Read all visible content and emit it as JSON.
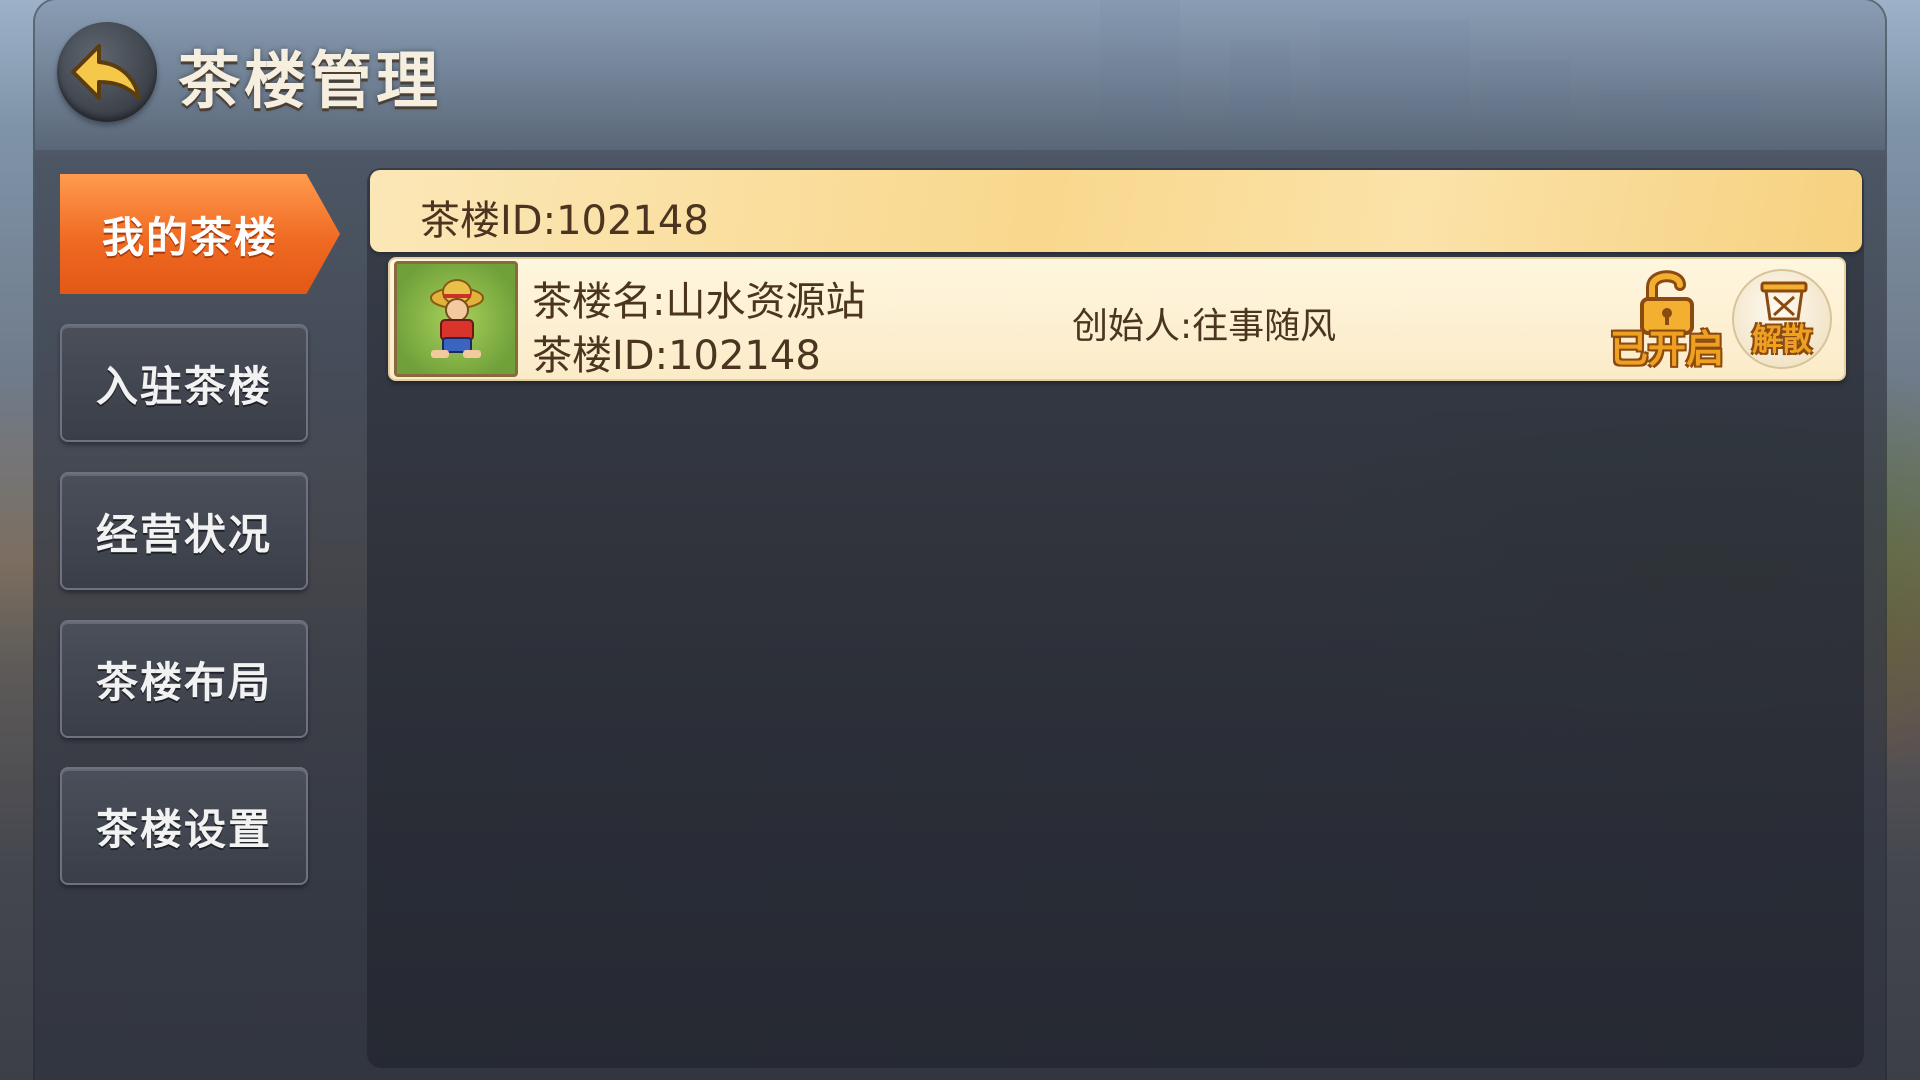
{
  "header": {
    "title": "茶楼管理",
    "back_icon": "back-arrow-icon"
  },
  "sidebar": {
    "items": [
      {
        "label": "我的茶楼",
        "active": true
      },
      {
        "label": "入驻茶楼",
        "active": false
      },
      {
        "label": "经营状况",
        "active": false
      },
      {
        "label": "茶楼布局",
        "active": false
      },
      {
        "label": "茶楼设置",
        "active": false
      }
    ]
  },
  "main": {
    "header_id": "茶楼ID:102148",
    "houses": [
      {
        "name": "茶楼名:山水资源站",
        "id": "茶楼ID:102148",
        "founder": "创始人:往事随风",
        "open_label": "已开启",
        "disband_label": "解散"
      }
    ]
  },
  "colors": {
    "accent": "#f06a22",
    "header_bar": "#f9d88d",
    "row_bg": "#fff6df",
    "text_dark": "#4b3520",
    "button_gold": "#f0a020"
  }
}
